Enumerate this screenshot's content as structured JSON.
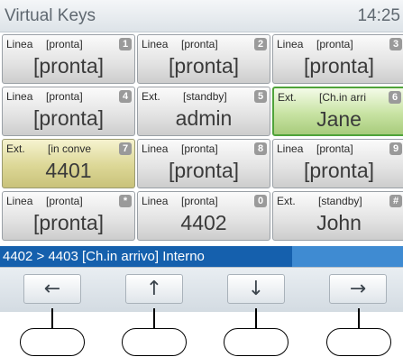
{
  "title": "Virtual Keys",
  "clock": "14:25",
  "keys": [
    {
      "type": "Linea",
      "status": "[pronta]",
      "num": "1",
      "main": "[pronta]",
      "style": "normal"
    },
    {
      "type": "Linea",
      "status": "[pronta]",
      "num": "2",
      "main": "[pronta]",
      "style": "normal"
    },
    {
      "type": "Linea",
      "status": "[pronta]",
      "num": "3",
      "main": "[pronta]",
      "style": "normal"
    },
    {
      "type": "Linea",
      "status": "[pronta]",
      "num": "4",
      "main": "[pronta]",
      "style": "normal"
    },
    {
      "type": "Ext.",
      "status": "[standby]",
      "num": "5",
      "main": "admin",
      "style": "normal"
    },
    {
      "type": "Ext.",
      "status": "[Ch.in arri",
      "num": "6",
      "main": "Jane",
      "style": "green"
    },
    {
      "type": "Ext.",
      "status": "[in conve",
      "num": "7",
      "main": "4401",
      "style": "olive"
    },
    {
      "type": "Linea",
      "status": "[pronta]",
      "num": "8",
      "main": "[pronta]",
      "style": "normal"
    },
    {
      "type": "Linea",
      "status": "[pronta]",
      "num": "9",
      "main": "[pronta]",
      "style": "normal"
    },
    {
      "type": "Linea",
      "status": "[pronta]",
      "num": "*",
      "main": "[pronta]",
      "style": "normal"
    },
    {
      "type": "Linea",
      "status": "[pronta]",
      "num": "0",
      "main": "4402",
      "style": "normal"
    },
    {
      "type": "Ext.",
      "status": "[standby]",
      "num": "#",
      "main": "John",
      "style": "normal"
    }
  ],
  "status_message": "4402 > 4403 [Ch.in arrivo] Interno",
  "softkeys": [
    {
      "icon": "arrow-left-icon",
      "glyph": "←"
    },
    {
      "icon": "arrow-up-icon",
      "glyph": "↑"
    },
    {
      "icon": "arrow-down-icon",
      "glyph": "↓"
    },
    {
      "icon": "arrow-right-icon",
      "glyph": "→"
    }
  ]
}
